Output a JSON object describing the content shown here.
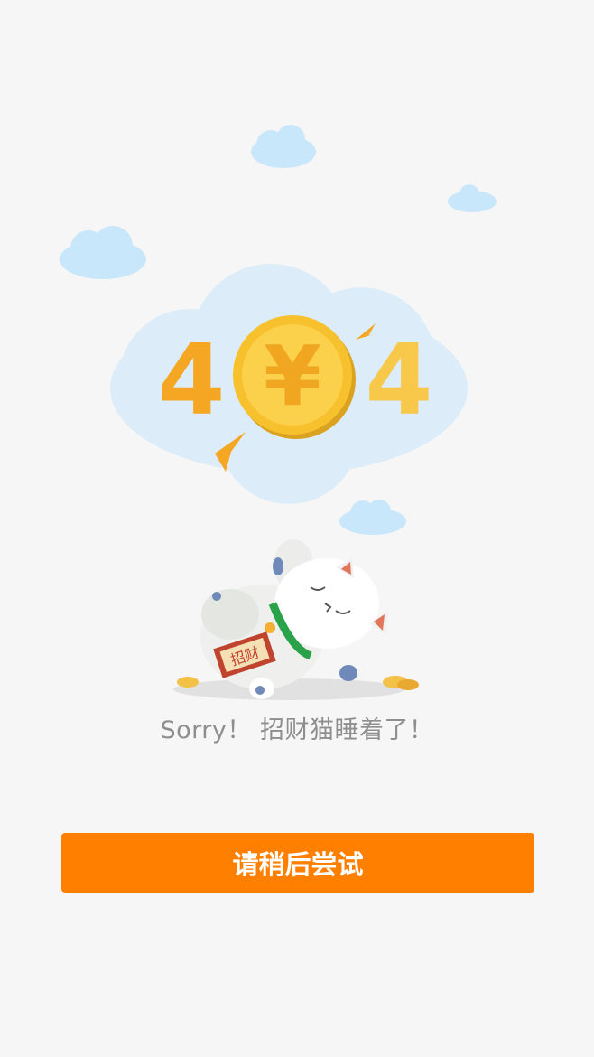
{
  "error": {
    "code_left_digit": "4",
    "code_right_digit": "4",
    "coin_symbol": "¥",
    "badge_text": "招财",
    "message": "Sorry！ 招财猫睡着了！"
  },
  "actions": {
    "retry_label": "请稍后尝试"
  },
  "colors": {
    "background": "#f6f6f6",
    "accent": "#ff7f00",
    "cloud": "#c9e7fa",
    "big_cloud": "#dcedf9",
    "coin": "#f7c12e",
    "digit": "#f5a623"
  }
}
